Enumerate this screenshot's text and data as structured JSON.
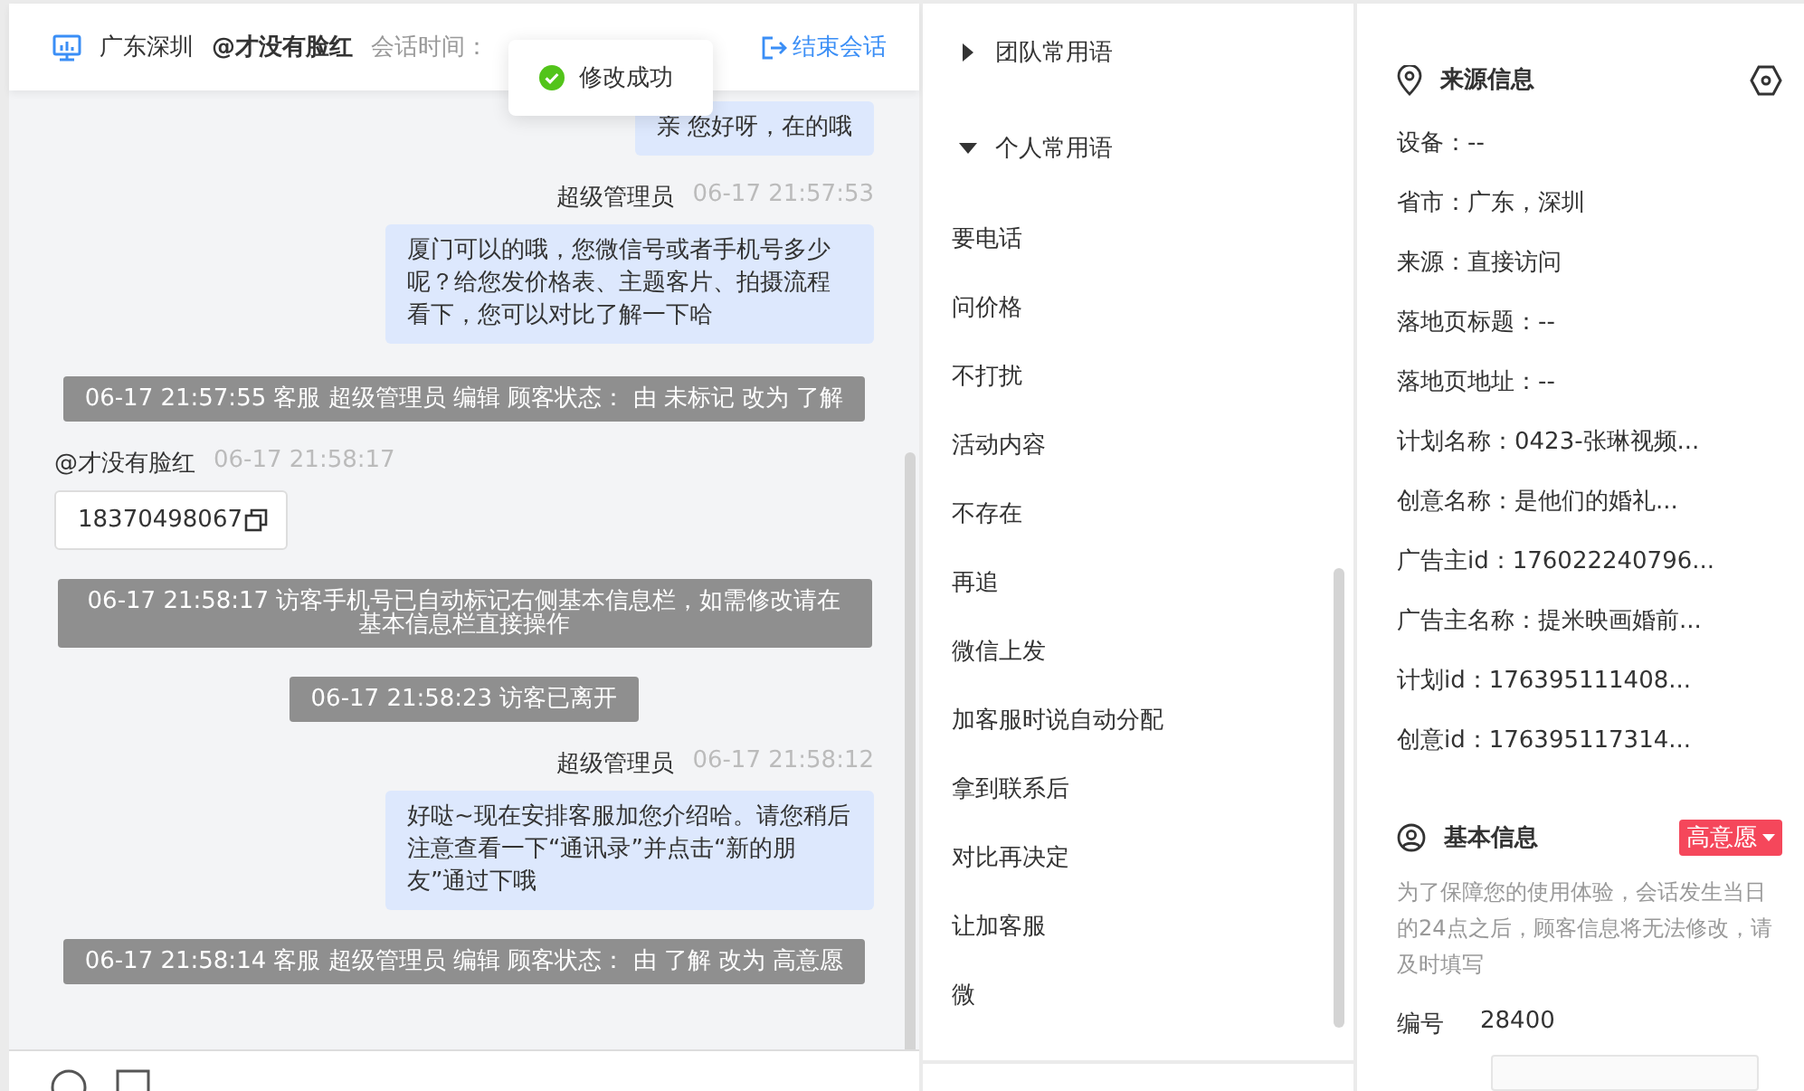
{
  "chat": {
    "header": {
      "location": "广东深圳",
      "visitor": "@才没有脸红",
      "session_label": "会话时间：",
      "end_button": "结束会话"
    },
    "toast": {
      "text": "修改成功"
    },
    "messages": [
      {
        "kind": "agent",
        "text": "亲 您好呀，在的哦"
      },
      {
        "kind": "agent",
        "name": "超级管理员",
        "time": "06-17 21:57:53",
        "text": "厦门可以的哦，您微信号或者手机号多少呢？给您发价格表、主题客片、拍摄流程看下，您可以对比了解一下哈"
      },
      {
        "kind": "system",
        "text": "06-17 21:57:55 客服 超级管理员 编辑 顾客状态： 由 未标记 改为 了解"
      },
      {
        "kind": "visitor",
        "name": "@才没有脸红",
        "time": "06-17 21:58:17",
        "text": "18370498067"
      },
      {
        "kind": "system",
        "text": "06-17 21:58:17 访客手机号已自动标记右侧基本信息栏，如需修改请在基本信息栏直接操作"
      },
      {
        "kind": "system",
        "text": "06-17 21:58:23 访客已离开"
      },
      {
        "kind": "agent",
        "name": "超级管理员",
        "time": "06-17 21:58:12",
        "text": "好哒~现在安排客服加您介绍哈。请您稍后注意查看一下“通讯录”并点击“新的朋友”通过下哦"
      },
      {
        "kind": "system",
        "text": "06-17 21:58:14 客服 超级管理员 编辑 顾客状态： 由 了解 改为 高意愿"
      }
    ]
  },
  "phrases": {
    "groups": [
      {
        "title": "团队常用语",
        "expanded": false
      },
      {
        "title": "个人常用语",
        "expanded": true
      }
    ],
    "items": [
      "要电话",
      "问价格",
      "不打扰",
      "活动内容",
      "不存在",
      "再追",
      "微信上发",
      "加客服时说自动分配",
      "拿到联系后",
      "对比再决定",
      "让加客服",
      "微"
    ]
  },
  "info": {
    "source_title": "来源信息",
    "source_rows": [
      "设备：--",
      "省市：广东，深圳",
      "来源：直接访问",
      "落地页标题：--",
      "落地页地址：--",
      "计划名称：0423-张琳视频...",
      "创意名称：是他们的婚礼...",
      "广告主id：176022240796...",
      "广告主名称：提米映画婚前...",
      "计划id：176395111408...",
      "创意id：176395117314..."
    ],
    "basic_title": "基本信息",
    "intent_tag": {
      "text": "高意愿",
      "color": "#f5475b"
    },
    "notice": "为了保障您的使用体验，会话发生当日的24点之后，顾客信息将无法修改，请及时填写",
    "fields": [
      {
        "label": "编号",
        "value": "28400"
      }
    ]
  }
}
